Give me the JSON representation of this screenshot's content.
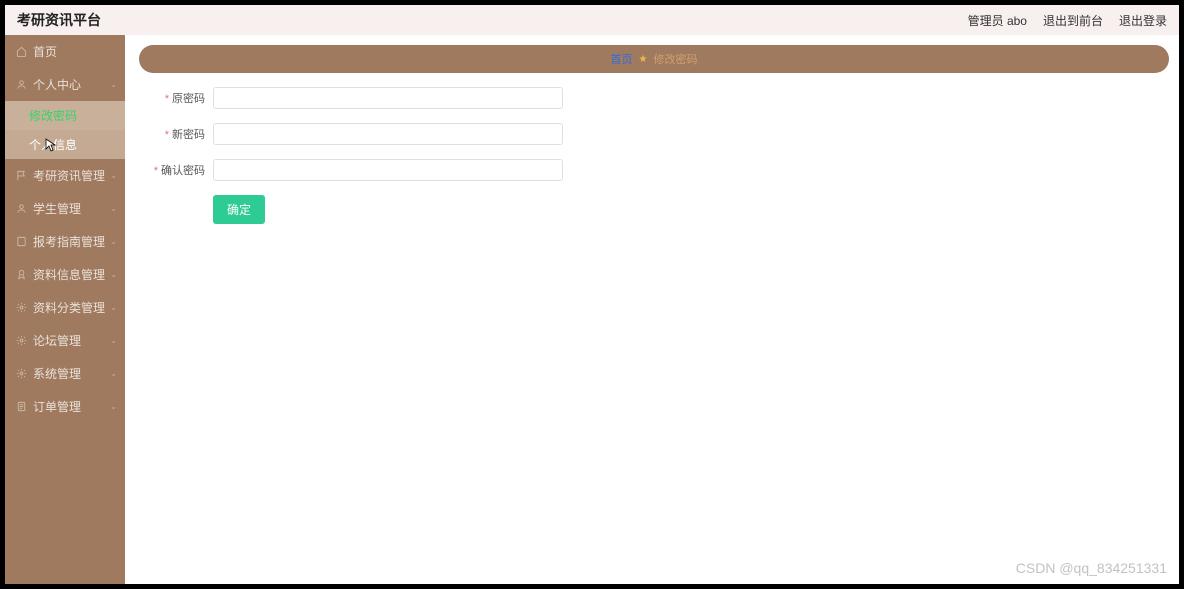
{
  "header": {
    "title": "考研资讯平台",
    "admin_label": "管理员 abo",
    "to_front_label": "退出到前台",
    "logout_label": "退出登录"
  },
  "sidebar": {
    "items": [
      {
        "icon": "home",
        "label": "首页",
        "expandable": false
      },
      {
        "icon": "user",
        "label": "个人中心",
        "expandable": true,
        "expanded": true,
        "children": [
          {
            "label": "修改密码",
            "active": true
          },
          {
            "label": "个人信息",
            "active": false
          }
        ]
      },
      {
        "icon": "flag",
        "label": "考研资讯管理",
        "expandable": true
      },
      {
        "icon": "user",
        "label": "学生管理",
        "expandable": true
      },
      {
        "icon": "book",
        "label": "报考指南管理",
        "expandable": true
      },
      {
        "icon": "ribbon",
        "label": "资料信息管理",
        "expandable": true
      },
      {
        "icon": "gear",
        "label": "资料分类管理",
        "expandable": true
      },
      {
        "icon": "gear",
        "label": "论坛管理",
        "expandable": true
      },
      {
        "icon": "gear",
        "label": "系统管理",
        "expandable": true
      },
      {
        "icon": "doc",
        "label": "订单管理",
        "expandable": true
      }
    ]
  },
  "breadcrumb": {
    "home": "首页",
    "current": "修改密码"
  },
  "form": {
    "old_password_label": "原密码",
    "new_password_label": "新密码",
    "confirm_password_label": "确认密码",
    "old_password_value": "",
    "new_password_value": "",
    "confirm_password_value": "",
    "submit_label": "确定"
  },
  "watermark": "CSDN @qq_834251331"
}
